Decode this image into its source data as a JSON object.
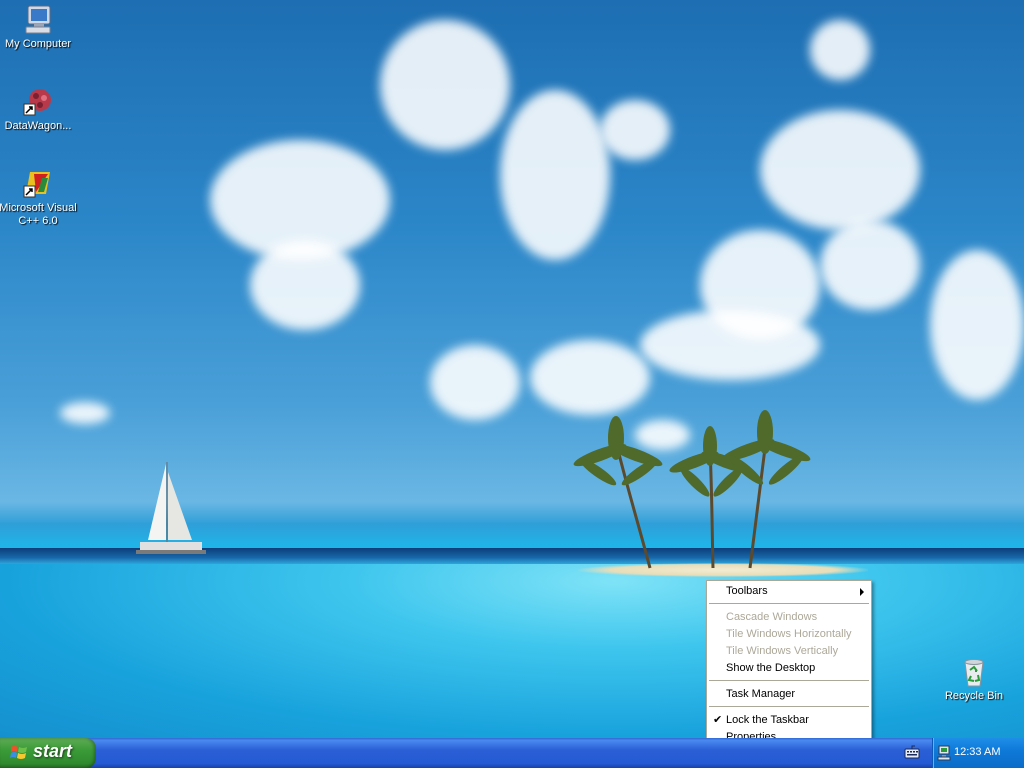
{
  "desktop": {
    "icons": [
      {
        "label": "My Computer",
        "icon": "my-computer-icon"
      },
      {
        "label": "DataWagon...",
        "icon": "datawagon-shortcut-icon"
      },
      {
        "label": "Microsoft Visual C++ 6.0",
        "icon": "visual-cpp-shortcut-icon"
      },
      {
        "label": "Recycle Bin",
        "icon": "recycle-bin-icon"
      }
    ]
  },
  "context_menu": {
    "items": [
      {
        "label": "Toolbars",
        "enabled": true,
        "submenu": true
      },
      {
        "label": "Cascade Windows",
        "enabled": false
      },
      {
        "label": "Tile Windows Horizontally",
        "enabled": false
      },
      {
        "label": "Tile Windows Vertically",
        "enabled": false
      },
      {
        "label": "Show the Desktop",
        "enabled": true
      },
      {
        "label": "Task Manager",
        "enabled": true
      },
      {
        "label": "Lock the Taskbar",
        "enabled": true,
        "checked": true
      },
      {
        "label": "Properties",
        "enabled": true
      }
    ]
  },
  "taskbar": {
    "start_label": "start",
    "clock": "12:33 AM"
  },
  "colors": {
    "taskbar_blue": "#245ad3",
    "start_green": "#3c9b38",
    "tray_blue": "#0f7ad9",
    "menu_disabled": "#aca899"
  }
}
